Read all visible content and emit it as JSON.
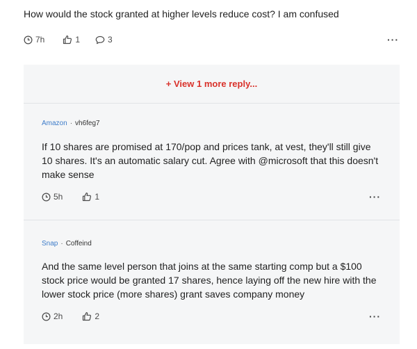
{
  "parent": {
    "text": "How would the stock granted at higher levels reduce cost? I am confused",
    "time": "7h",
    "likes": "1",
    "comments": "3"
  },
  "view_more_label": "+ View 1 more reply...",
  "replies": [
    {
      "company": "Amazon",
      "separator": "·",
      "handle": "vh6feg7",
      "text": "If 10 shares are promised at 170/pop and prices tank, at vest, they'll still give 10 shares. It's an automatic salary cut. Agree with @microsoft that this doesn't make sense",
      "time": "5h",
      "likes": "1"
    },
    {
      "company": "Snap",
      "separator": "·",
      "handle": "Coffeind",
      "text": "And the same level person that joins at the same starting comp but a $100 stock price would be granted 17 shares, hence laying off the new hire with the lower stock price (more shares) grant saves company money",
      "time": "2h",
      "likes": "2"
    }
  ],
  "more_label": "···",
  "colors": {
    "accent_red": "#d9322b",
    "company_link": "#3d7cc9",
    "thread_bg": "#f5f6f7"
  },
  "icons": [
    "clock-icon",
    "thumbs-up-icon",
    "comment-icon",
    "more-options-icon"
  ]
}
